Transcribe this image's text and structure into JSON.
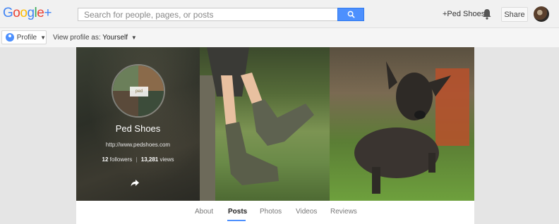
{
  "topbar": {
    "logo_letters": [
      {
        "char": "G",
        "color": "#4285f4"
      },
      {
        "char": "o",
        "color": "#ea4335"
      },
      {
        "char": "o",
        "color": "#fbbc05"
      },
      {
        "char": "g",
        "color": "#4285f4"
      },
      {
        "char": "l",
        "color": "#34a853"
      },
      {
        "char": "e",
        "color": "#ea4335"
      },
      {
        "char": "+",
        "color": "#4285f4"
      }
    ],
    "search_placeholder": "Search for people, pages, or posts",
    "plus_link": "+Ped Shoes",
    "share_label": "Share"
  },
  "subbar": {
    "profile_label": "Profile",
    "view_as_prefix": "View profile as:",
    "view_as_value": "Yourself"
  },
  "profile": {
    "name": "Ped Shoes",
    "logo_text": "ped",
    "url": "http://www.pedshoes.com",
    "followers_count": "12",
    "followers_label": "followers",
    "views_count": "13,281",
    "views_label": "views"
  },
  "tabs": [
    {
      "label": "About"
    },
    {
      "label": "Posts",
      "active": true
    },
    {
      "label": "Photos"
    },
    {
      "label": "Videos"
    },
    {
      "label": "Reviews"
    }
  ],
  "colors": {
    "accent": "#4d90fe"
  }
}
